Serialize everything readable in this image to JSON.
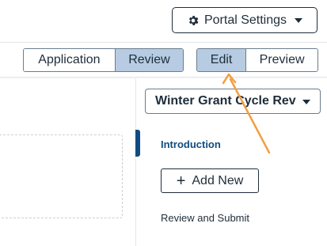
{
  "header": {
    "portal_settings_label": "Portal Settings",
    "portal_settings_icon": "gear-icon"
  },
  "toolbar": {
    "view_toggle": [
      {
        "label": "Application",
        "active": false
      },
      {
        "label": "Review",
        "active": true
      }
    ],
    "mode_toggle": [
      {
        "label": "Edit",
        "active": true
      },
      {
        "label": "Preview",
        "active": false
      }
    ]
  },
  "sidebar": {
    "cycle_select_value": "Winter Grant Cycle Rev",
    "items": [
      {
        "label": "Introduction",
        "active": true
      },
      {
        "label": "Review and Submit",
        "active": false
      }
    ],
    "add_new_label": "Add New"
  },
  "colors": {
    "active_segment": "#b7cce3",
    "accent": "#0f4c81",
    "annotation_arrow": "#f0a040"
  }
}
